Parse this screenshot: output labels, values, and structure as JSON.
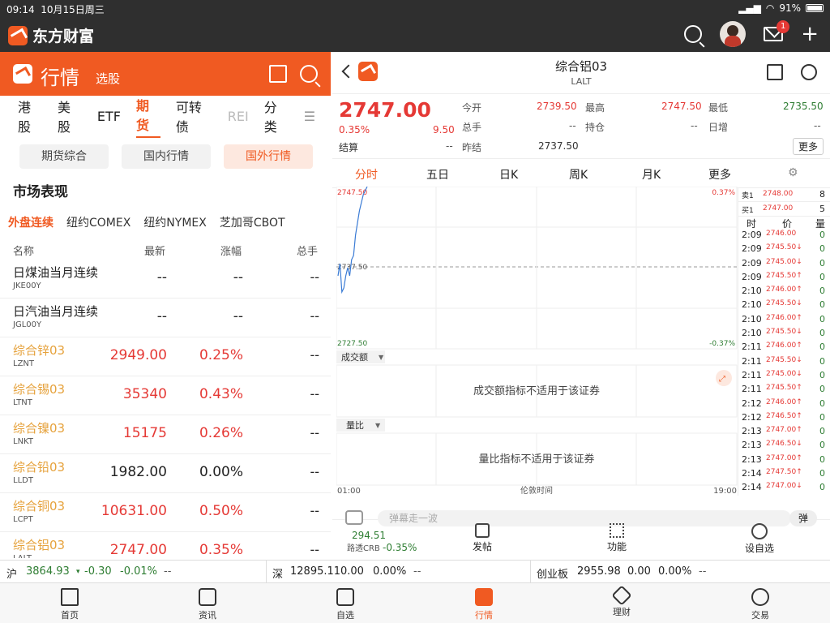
{
  "status": {
    "time": "09:14",
    "date": "10月15日周三",
    "battery": "91%"
  },
  "app": {
    "name": "东方财富",
    "mail_badge": "1"
  },
  "left": {
    "title": "行情",
    "subtitle": "选股",
    "tabs": [
      "港股",
      "美股",
      "ETF",
      "期货",
      "可转债",
      "REI",
      "分类"
    ],
    "pills": [
      "期货综合",
      "国内行情",
      "国外行情"
    ],
    "section": "市场表现",
    "subtabs": [
      "外盘连续",
      "纽约COMEX",
      "纽约NYMEX",
      "芝加哥CBOT"
    ],
    "headers": [
      "名称",
      "最新",
      "涨幅",
      "总手"
    ],
    "rows": [
      {
        "name": "日煤油当月连续",
        "code": "JKE00Y",
        "price": "--",
        "pct": "--",
        "vol": "--"
      },
      {
        "name": "日汽油当月连续",
        "code": "JGL00Y",
        "price": "--",
        "pct": "--",
        "vol": "--"
      },
      {
        "name": "综合锌03",
        "code": "LZNT",
        "price": "2949.00",
        "pct": "0.25%",
        "vol": "--"
      },
      {
        "name": "综合锡03",
        "code": "LTNT",
        "price": "35340",
        "pct": "0.43%",
        "vol": "--"
      },
      {
        "name": "综合镍03",
        "code": "LNKT",
        "price": "15175",
        "pct": "0.26%",
        "vol": "--"
      },
      {
        "name": "综合铅03",
        "code": "LLDT",
        "price": "1982.00",
        "pct": "0.00%",
        "vol": "--"
      },
      {
        "name": "综合铜03",
        "code": "LCPT",
        "price": "10631.00",
        "pct": "0.50%",
        "vol": "--"
      },
      {
        "name": "综合铝03",
        "code": "LALT",
        "price": "2747.00",
        "pct": "0.35%",
        "vol": "--"
      }
    ]
  },
  "right": {
    "title": "综合铝03",
    "code": "LALT",
    "price": "2747.00",
    "pct": "0.35%",
    "change": "9.50",
    "fields": {
      "今开": "2739.50",
      "最高": "2747.50",
      "最低": "2735.50",
      "总手": "--",
      "持仓": "--",
      "日增": "--",
      "结算": "--",
      "昨结": "2737.50"
    },
    "more": "更多",
    "chart_tabs": [
      "分时",
      "五日",
      "日K",
      "周K",
      "月K",
      "更多"
    ],
    "chart_labels": {
      "top": "2747.50",
      "mid": "2737.50",
      "bottom": "2727.50",
      "top_pct": "0.37%",
      "bottom_pct": "-0.37%",
      "start": "01:00",
      "center": "伦敦时间",
      "end": "19:00"
    },
    "panel1": "成交额",
    "panel1_msg": "成交额指标不适用于该证券",
    "panel2": "量比",
    "panel2_msg": "量比指标不适用于该证券",
    "orderbook": {
      "sell": {
        "label": "卖1",
        "price": "2748.00",
        "vol": "8"
      },
      "buy": {
        "label": "买1",
        "price": "2747.00",
        "vol": "5"
      },
      "headers": [
        "时",
        "价",
        "量"
      ],
      "ticks": [
        [
          "2:09",
          "2746.00",
          "0"
        ],
        [
          "2:09",
          "2745.50↓",
          "0"
        ],
        [
          "2:09",
          "2745.00↓",
          "0"
        ],
        [
          "2:09",
          "2745.50↑",
          "0"
        ],
        [
          "2:10",
          "2746.00↑",
          "0"
        ],
        [
          "2:10",
          "2745.50↓",
          "0"
        ],
        [
          "2:10",
          "2746.00↑",
          "0"
        ],
        [
          "2:10",
          "2745.50↓",
          "0"
        ],
        [
          "2:11",
          "2746.00↑",
          "0"
        ],
        [
          "2:11",
          "2745.50↓",
          "0"
        ],
        [
          "2:11",
          "2745.00↓",
          "0"
        ],
        [
          "2:11",
          "2745.50↑",
          "0"
        ],
        [
          "2:12",
          "2746.00↑",
          "0"
        ],
        [
          "2:12",
          "2746.50↑",
          "0"
        ],
        [
          "2:13",
          "2747.00↑",
          "0"
        ],
        [
          "2:13",
          "2746.50↓",
          "0"
        ],
        [
          "2:13",
          "2747.00↑",
          "0"
        ],
        [
          "2:14",
          "2747.50↑",
          "0"
        ],
        [
          "2:14",
          "2747.00↓",
          "0"
        ]
      ]
    },
    "comment_placeholder": "弹幕走一波",
    "comment_btn": "弹",
    "bottom": {
      "idx_val": "294.51",
      "idx_name": "路透CRB",
      "idx_pct": "-0.35%",
      "btns": [
        "发帖",
        "功能",
        "设自选"
      ]
    }
  },
  "indices": [
    {
      "name": "沪",
      "val": "3864.93",
      "chg": "-0.30",
      "pct": "-0.01%",
      "extra": "--"
    },
    {
      "name": "深",
      "val": "12895.11",
      "chg": "0.00",
      "pct": "0.00%",
      "extra": "--"
    },
    {
      "name": "创业板",
      "val": "2955.98",
      "chg": "0.00",
      "pct": "0.00%",
      "extra": "--"
    }
  ],
  "tabbar": [
    "首页",
    "资讯",
    "自选",
    "行情",
    "理财",
    "交易"
  ],
  "chart_data": {
    "type": "line",
    "x": [
      "01:00",
      "19:00"
    ],
    "ylim": [
      2727.5,
      2747.5
    ],
    "xlabel": "伦敦时间",
    "values": [
      2736.5,
      2738.0,
      2734.5,
      2735.0,
      2736.5,
      2737.5,
      2736.5,
      2738.5,
      2739.0,
      2741.5,
      2743.0,
      2744.5,
      2745.5,
      2746.5,
      2747.0,
      2747.5
    ]
  }
}
